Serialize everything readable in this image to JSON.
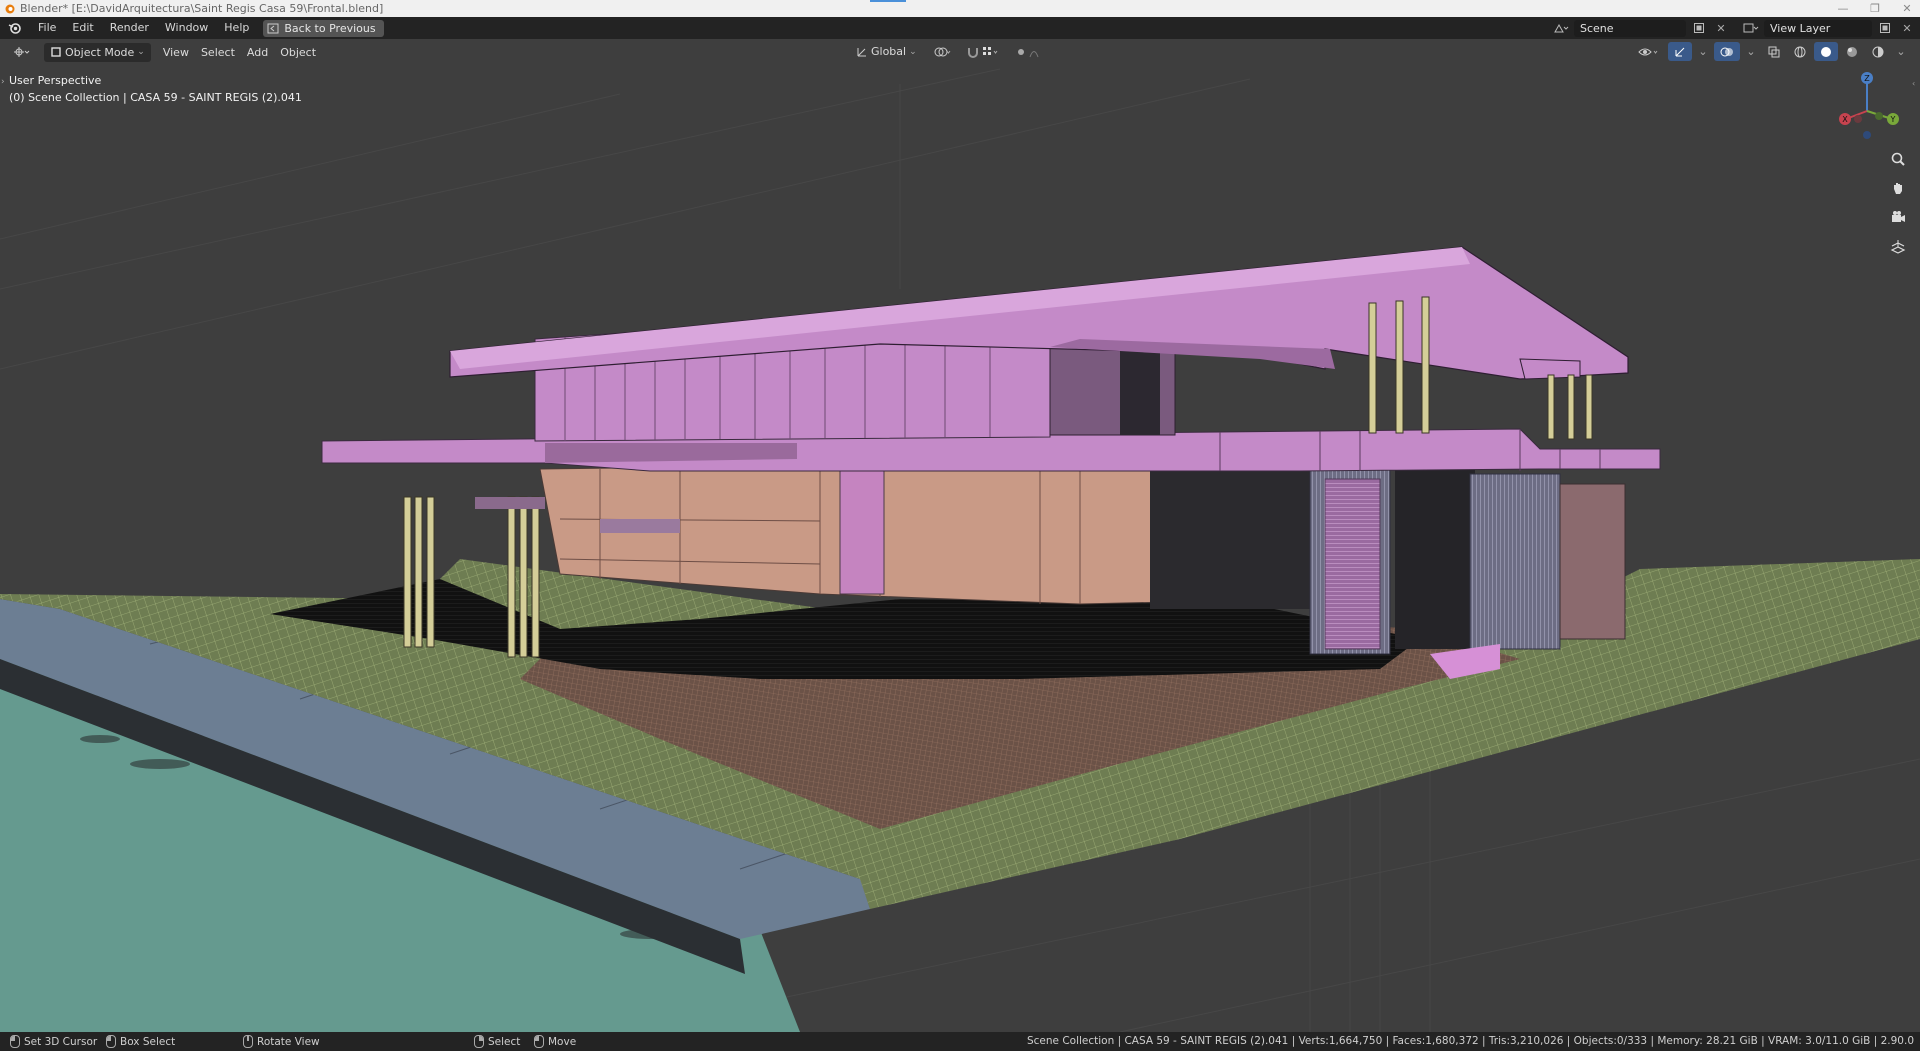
{
  "window": {
    "title": "Blender* [E:\\DavidArquitectura\\Saint Regis Casa 59\\Frontal.blend]",
    "controls": [
      "—",
      "❐",
      "✕"
    ]
  },
  "menu": {
    "items": [
      "File",
      "Edit",
      "Render",
      "Window",
      "Help"
    ],
    "back_button": "Back to Previous",
    "scene": "Scene",
    "view_layer": "View Layer"
  },
  "viewport_header": {
    "mode": "Object Mode",
    "menus": [
      "View",
      "Select",
      "Add",
      "Object"
    ],
    "transform_orientation": "Global"
  },
  "viewport": {
    "perspective_label": "User Perspective",
    "collection_label": "(0) Scene Collection | CASA 59 - SAINT REGIS (2).041",
    "gizmo_axes": [
      "X",
      "Y",
      "Z"
    ],
    "colors": {
      "background": "#3e3e3e",
      "roof": "#c48ac8",
      "walls": "#c6858f",
      "columns": "#d4cf9a",
      "lawn": "#7a8a5a",
      "terrace": "#8a6a5a",
      "water": "#6a9a90",
      "curb": "#6f7f90"
    }
  },
  "statusbar": {
    "set_cursor": "Set 3D Cursor",
    "box_select": "Box Select",
    "rotate_view": "Rotate View",
    "select": "Select",
    "move": "Move",
    "stats": "Scene Collection | CASA 59 - SAINT REGIS (2).041 | Verts:1,664,750 | Faces:1,680,372 | Tris:3,210,026 | Objects:0/333 | Memory: 28.21 GiB | VRAM: 3.0/11.0 GiB | 2.90.0"
  }
}
